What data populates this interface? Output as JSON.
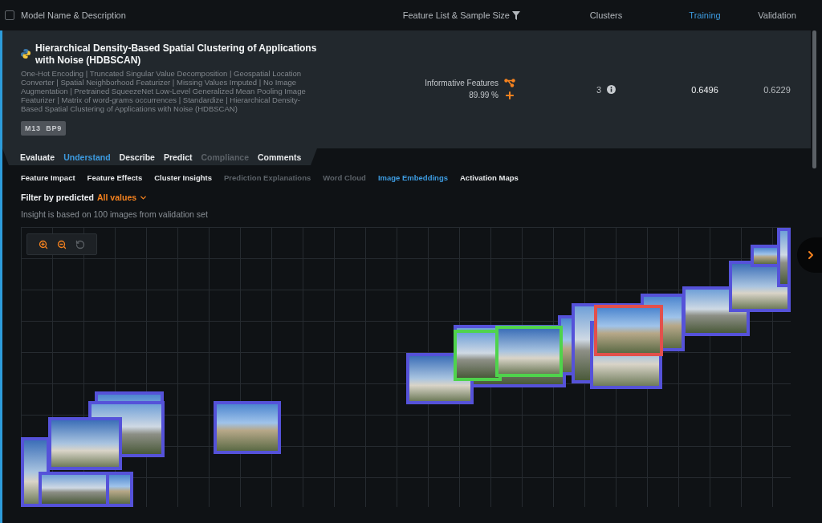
{
  "table_header": {
    "checked": false,
    "columns": [
      {
        "label": "Model Name & Description",
        "kind": "text",
        "selected": false
      },
      {
        "label": "Feature List & Sample Size",
        "kind": "filter",
        "selected": false
      },
      {
        "label": "Clusters",
        "kind": "text",
        "selected": false
      },
      {
        "label": "Training",
        "kind": "text",
        "selected": true
      },
      {
        "label": "Validation",
        "kind": "text",
        "selected": false
      }
    ]
  },
  "model": {
    "selected": true,
    "title": "Hierarchical Density-Based Spatial Clustering of Applications with Noise (HDBSCAN)",
    "description": "One-Hot Encoding | Truncated Singular Value Decomposition | Geospatial Location Converter | Spatial Neighborhood Featurizer | Missing Values Imputed | No Image Augmentation | Pretrained SqueezeNet Low-Level Generalized Mean Pooling Image Featurizer | Matrix of word-grams occurrences | Standardize | Hierarchical Density-Based Spatial Clustering of Applications with Noise (HDBSCAN)",
    "badge": "M13 BP9",
    "feature_list": "Informative Features",
    "sample_size": "89.99 %",
    "clusters": "3",
    "training": "0.6496",
    "validation": "0.6229"
  },
  "tabs": [
    {
      "label": "Evaluate",
      "selected": false,
      "disabled": false
    },
    {
      "label": "Understand",
      "selected": true,
      "disabled": false
    },
    {
      "label": "Describe",
      "selected": false,
      "disabled": false
    },
    {
      "label": "Predict",
      "selected": false,
      "disabled": false
    },
    {
      "label": "Compliance",
      "selected": false,
      "disabled": true
    },
    {
      "label": "Comments",
      "selected": false,
      "disabled": false
    }
  ],
  "subtabs": [
    {
      "label": "Feature Impact",
      "selected": false,
      "disabled": false
    },
    {
      "label": "Feature Effects",
      "selected": false,
      "disabled": false
    },
    {
      "label": "Cluster Insights",
      "selected": false,
      "disabled": false
    },
    {
      "label": "Prediction Explanations",
      "selected": false,
      "disabled": true
    },
    {
      "label": "Word Cloud",
      "selected": false,
      "disabled": true
    },
    {
      "label": "Image Embeddings",
      "selected": true,
      "disabled": false
    },
    {
      "label": "Activation Maps",
      "selected": false,
      "disabled": false
    }
  ],
  "filter": {
    "label": "Filter by predicted",
    "value": "All values"
  },
  "note": "Insight is based on 100 images from validation set",
  "embeddings": {
    "tools": [
      {
        "kind": "zoom_in",
        "disabled": false
      },
      {
        "kind": "zoom_out",
        "disabled": false
      },
      {
        "kind": "reset",
        "disabled": true
      }
    ],
    "thumbnails": [
      {
        "color": "#5552d9"
      },
      {
        "color": "#5552d9"
      },
      {
        "color": "#5552d9"
      },
      {
        "color": "#5552d9"
      },
      {
        "color": "#5552d9"
      },
      {
        "color": "#5552d9"
      },
      {
        "color": "#5552d9"
      },
      {
        "color": "#5552d9"
      },
      {
        "color": "#5552d9"
      },
      {
        "color": "#5552d9"
      },
      {
        "color": "#5552d9"
      },
      {
        "color": "#5552d9"
      },
      {
        "color": "#5552d9"
      },
      {
        "color": "#4fd34c"
      },
      {
        "color": "#4fd34c"
      },
      {
        "color": "#e2504c"
      },
      {
        "color": "#5552d9"
      },
      {
        "color": "#5552d9"
      },
      {
        "color": "#5552d9"
      },
      {
        "color": "#5552d9"
      }
    ]
  }
}
